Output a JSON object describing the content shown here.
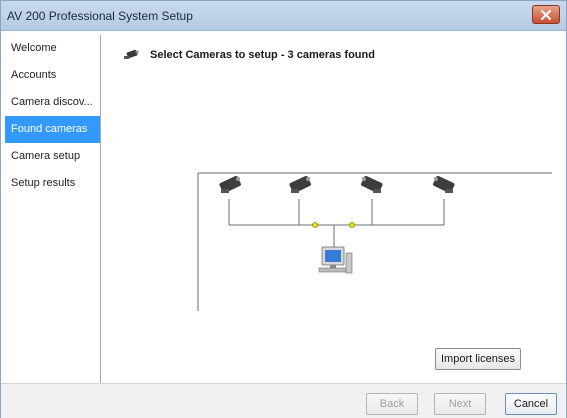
{
  "window": {
    "title": "AV 200 Professional System Setup"
  },
  "sidebar": {
    "items": [
      {
        "label": "Welcome",
        "active": false
      },
      {
        "label": "Accounts",
        "active": false
      },
      {
        "label": "Camera discov...",
        "active": false
      },
      {
        "label": "Found cameras",
        "active": true
      },
      {
        "label": "Camera setup",
        "active": false
      },
      {
        "label": "Setup results",
        "active": false
      }
    ]
  },
  "main": {
    "heading": "Select Cameras to setup - 3 cameras found",
    "import_label": "Import licenses"
  },
  "footer": {
    "back_label": "Back",
    "next_label": "Next",
    "cancel_label": "Cancel"
  },
  "colors": {
    "active_bg": "#3399ff",
    "titlebar": "#c9daee",
    "close": "#c74f33"
  }
}
